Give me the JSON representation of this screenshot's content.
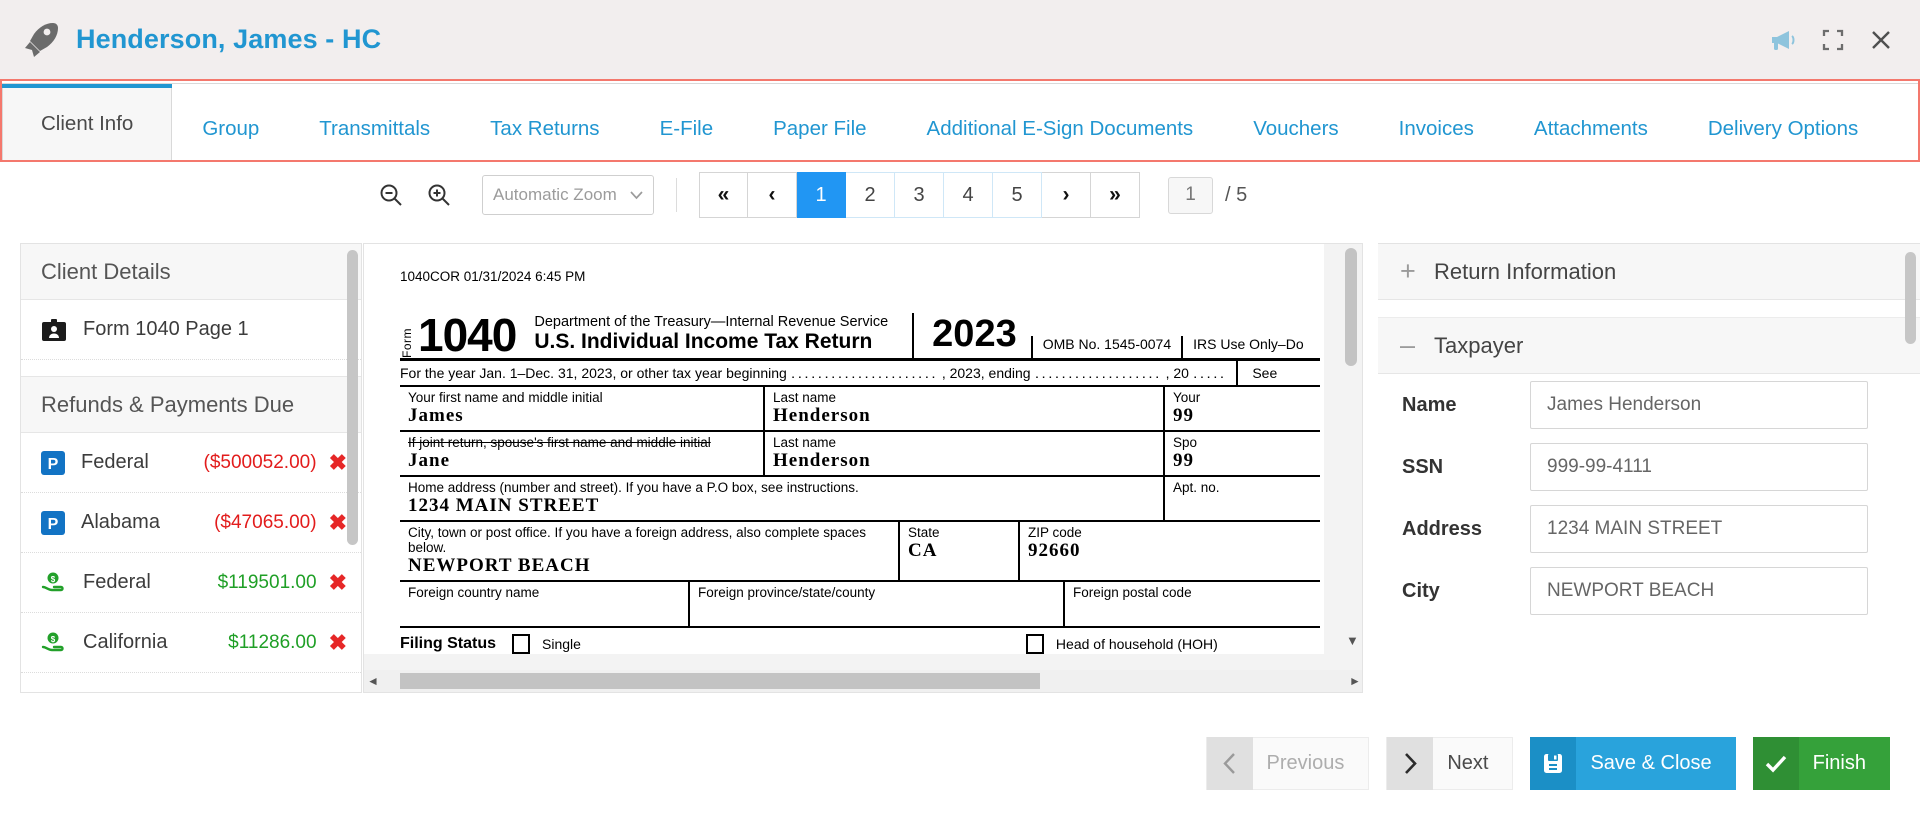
{
  "window": {
    "title": "Henderson, James - HC",
    "logo_icon": "rocket-icon",
    "actions": [
      {
        "name": "announcement-icon",
        "glyph": "megaphone"
      },
      {
        "name": "fullscreen-icon",
        "glyph": "expand"
      },
      {
        "name": "close-icon",
        "glyph": "times"
      }
    ]
  },
  "tabs": [
    {
      "label": "Client Info",
      "active": true
    },
    {
      "label": "Group",
      "active": false
    },
    {
      "label": "Transmittals",
      "active": false
    },
    {
      "label": "Tax Returns",
      "active": false
    },
    {
      "label": "E-File",
      "active": false
    },
    {
      "label": "Paper File",
      "active": false
    },
    {
      "label": "Additional E-Sign Documents",
      "active": false
    },
    {
      "label": "Vouchers",
      "active": false
    },
    {
      "label": "Invoices",
      "active": false
    },
    {
      "label": "Attachments",
      "active": false
    },
    {
      "label": "Delivery Options",
      "active": false
    }
  ],
  "pdf_toolbar": {
    "zoom_out_icon": "zoom-out-icon",
    "zoom_in_icon": "zoom-in-icon",
    "zoom_select_value": "Automatic Zoom",
    "first_page_label": "«",
    "prev_page_label": "‹",
    "next_page_label": "›",
    "last_page_label": "»",
    "pages": [
      "1",
      "2",
      "3",
      "4",
      "5"
    ],
    "active_page": "1",
    "page_input_value": "1",
    "page_total_label": "/ 5"
  },
  "sidebar": {
    "client_details_title": "Client Details",
    "form_row": {
      "label": "Form 1040 Page 1",
      "icon": "id-card-icon"
    },
    "refunds_title": "Refunds & Payments Due",
    "rows": [
      {
        "icon": "payment-icon",
        "label": "Federal",
        "amount": "($500052.00)",
        "sign": "neg",
        "delete": "✖"
      },
      {
        "icon": "payment-icon",
        "label": "Alabama",
        "amount": "($47065.00)",
        "sign": "neg",
        "delete": "✖"
      },
      {
        "icon": "refund-icon",
        "label": "Federal",
        "amount": "$119501.00",
        "sign": "pos",
        "delete": "✖"
      },
      {
        "icon": "refund-icon",
        "label": "California",
        "amount": "$11286.00",
        "sign": "pos",
        "delete": "✖"
      }
    ]
  },
  "pdf_document": {
    "meta_line": "1040COR 01/31/2024 6:45 PM",
    "form_label_vertical": "Form",
    "form_number": "1040",
    "dept_line": "Department of the Treasury—Internal Revenue Service",
    "form_title": "U.S. Individual Income Tax Return",
    "tax_year": "2023",
    "omb": "OMB No. 1545-0074",
    "irs_use": "IRS Use Only–Do",
    "year_line_left": "For the year Jan. 1–Dec. 31, 2023, or other tax year beginning",
    "year_line_dots": "․․․․․․․․․․․․․․․․․․․․․․",
    "year_line_mid": ", 2023, ending",
    "year_line_dots2": "․․․․․․․․․․․․․․․․․․․",
    "year_line_end": ", 20",
    "year_line_dots3": "․․․․․",
    "see_label": "See",
    "first_name_label": "Your first name and middle initial",
    "first_name_value": "James",
    "last_name_label": "Last name",
    "last_name_value": "Henderson",
    "your_ssn_label": "Your",
    "your_ssn_value": "99",
    "spouse_name_label": "If joint return, spouse's first name and middle initial",
    "spouse_name_value": "Jane",
    "spouse_last_name_label": "Last name",
    "spouse_last_name_value": "Henderson",
    "spouse_ssn_label": "Spo",
    "spouse_ssn_value": "99",
    "address_label": "Home address (number and street). If you have a P.O box, see instructions.",
    "address_value": "1234  MAIN  STREET",
    "apt_label": "Apt. no.",
    "city_label": "City, town or post office. If you have a foreign address, also complete spaces below.",
    "city_value": "NEWPORT  BEACH",
    "state_label": "State",
    "state_value": "CA",
    "zip_label": "ZIP code",
    "zip_value": "92660",
    "foreign_country_label": "Foreign country name",
    "foreign_province_label": "Foreign  province/state/county",
    "foreign_postal_label": "Foreign postal code",
    "filing_status_label": "Filing  Status",
    "filing_single_label": "Single",
    "filing_hoh_label": "Head of household (HOH)"
  },
  "right_panel": {
    "return_information_title": "Return Information",
    "return_information_sign": "+",
    "taxpayer_title": "Taxpayer",
    "taxpayer_sign": "–",
    "fields": [
      {
        "label": "Name",
        "value": "James Henderson"
      },
      {
        "label": "SSN",
        "value": "999-99-4111"
      },
      {
        "label": "Address",
        "value": "1234 MAIN STREET"
      },
      {
        "label": "City",
        "value": "NEWPORT BEACH"
      }
    ]
  },
  "footer": {
    "previous_label": "Previous",
    "next_label": "Next",
    "save_close_label": "Save & Close",
    "finish_label": "Finish"
  },
  "colors": {
    "accent_blue": "#2196d1",
    "tab_border_red": "#f4786d",
    "save_blue": "#29a3dc",
    "finish_green": "#35a13a",
    "negative_red": "#e21c1c",
    "positive_green": "#1f9f26"
  }
}
